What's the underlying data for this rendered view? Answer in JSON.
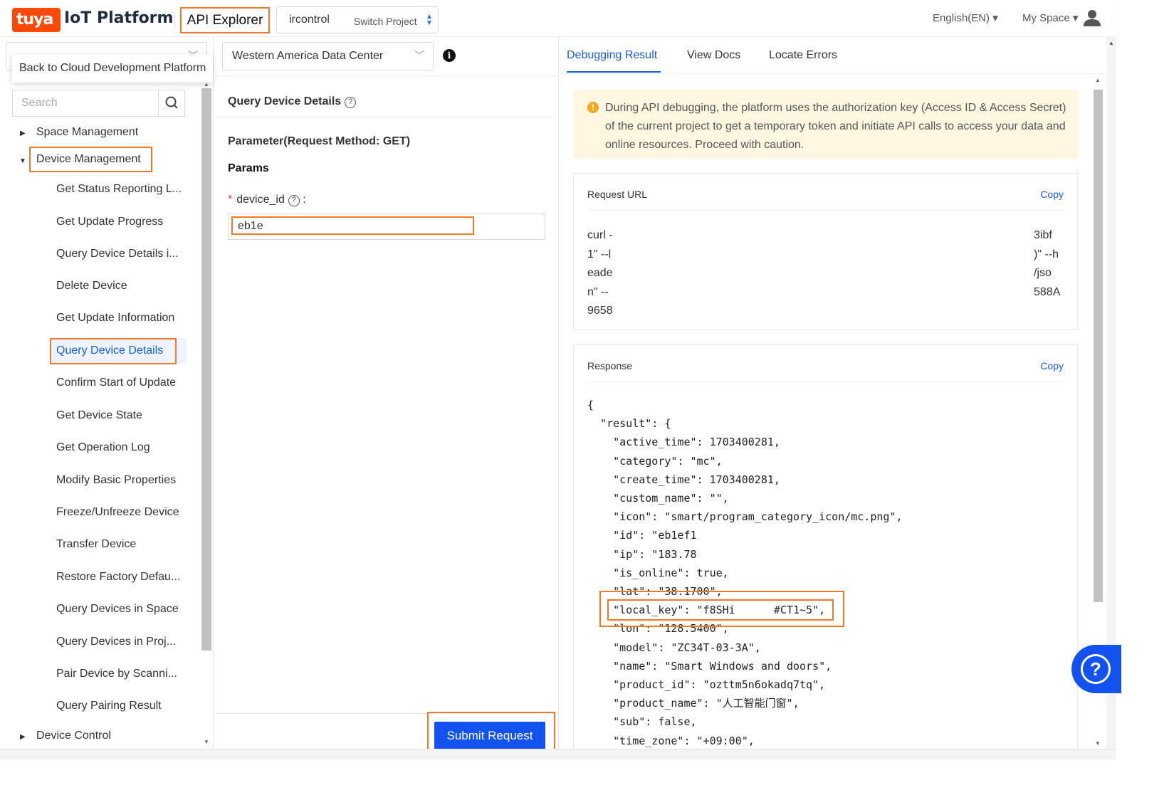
{
  "header": {
    "logo_text": "tuya",
    "platform_name": "IoT Platform",
    "api_explorer": "API Explorer",
    "project_name": "ircontrol",
    "switch_project": "Switch Project",
    "language": "English(EN) ▾",
    "my_space": "My Space ▾"
  },
  "left": {
    "tooltip": "Back to Cloud Development Platform",
    "search_placeholder": "Search",
    "space_management": "Space Management",
    "device_management": "Device Management",
    "device_control": "Device Control",
    "items": [
      "Get Status Reporting L...",
      "Get Update Progress",
      "Query Device Details i...",
      "Delete Device",
      "Get Update Information",
      "Query Device Details",
      "Confirm Start of Update",
      "Get Device State",
      "Get Operation Log",
      "Modify Basic Properties",
      "Freeze/Unfreeze Device",
      "Transfer Device",
      "Restore Factory Defau...",
      "Query Devices in Space",
      "Query Devices in Proj...",
      "Pair Device by Scanni...",
      "Query Pairing Result"
    ]
  },
  "middle": {
    "data_center": "Western America Data Center",
    "api_title": "Query Device Details",
    "param_title": "Parameter(Request Method: GET)",
    "params_label": "Params",
    "required_mark": "*",
    "field_label": "device_id",
    "field_colon": ":",
    "device_id_value": "eb1e",
    "submit": "Submit Request"
  },
  "right": {
    "tabs": [
      "Debugging Result",
      "View Docs",
      "Locate Errors"
    ],
    "warning": "During API debugging, the platform uses the authorization key (Access ID & Access Secret) of the current project to get a temporary token and initiate API calls to access your data and online resources. Proceed with caution.",
    "request_url_title": "Request URL",
    "copy": "Copy",
    "curl_left": "curl -\n1\" --l\neade\nn\" --\n9658",
    "curl_right": "3ibf\n)\" --h\n/jso\n588A",
    "response_title": "Response",
    "response_json": "{\n  \"result\": {\n    \"active_time\": 1703400281,\n    \"category\": \"mc\",\n    \"create_time\": 1703400281,\n    \"custom_name\": \"\",\n    \"icon\": \"smart/program_category_icon/mc.png\",\n    \"id\": \"eb1ef1\n    \"ip\": \"183.78\n    \"is_online\": true,\n    \"lat\": \"38.1700\",\n    \"local_key\": \"f8SHi      #CT1~5\",\n    \"lon\": \"128.5400\",\n    \"model\": \"ZC34T-03-3A\",\n    \"name\": \"Smart Windows and doors\",\n    \"product_id\": \"ozttm5n6okadq7tq\",\n    \"product_name\": \"人工智能门窗\",\n    \"sub\": false,\n    \"time_zone\": \"+09:00\","
  },
  "colors": {
    "brand": "#ff4800",
    "accent": "#1252f0",
    "highlight": "#f07a28",
    "link": "#1a5fd8"
  }
}
